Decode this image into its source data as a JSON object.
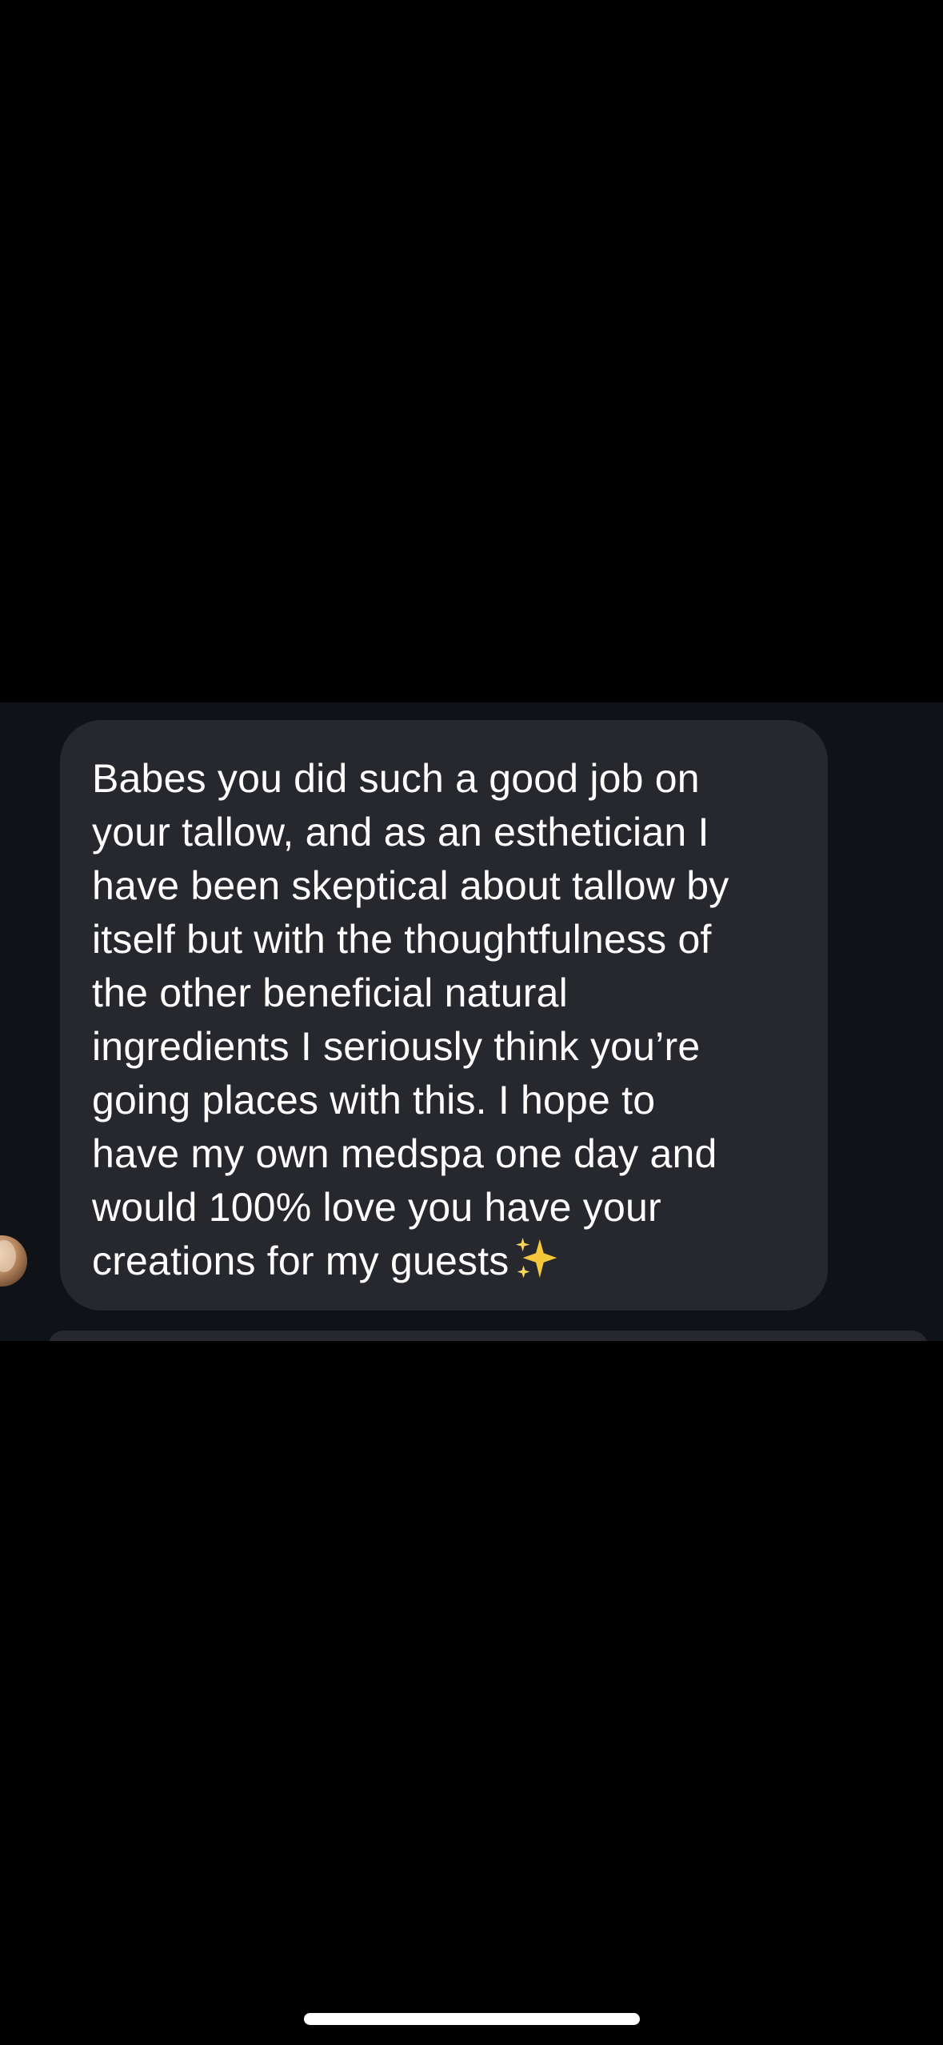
{
  "conversation": {
    "message": {
      "text": "Babes you did such a good job on\nyour tallow, and as an esthetician I\nhave been skeptical about tallow by\nitself but with the thoughtfulness of\nthe other beneficial natural\ningredients I seriously think you’re\ngoing places with this. I hope to\nhave my own medspa one day and\nwould 100% love you have your\ncreations for my guests",
      "emoji_icon": "sparkles-icon",
      "sender_avatar": "avatar"
    }
  },
  "colors": {
    "background": "#000000",
    "thread_background": "#0f1216",
    "bubble": "#26282e",
    "text": "#ffffff",
    "sparkle": "#f5c73a"
  }
}
